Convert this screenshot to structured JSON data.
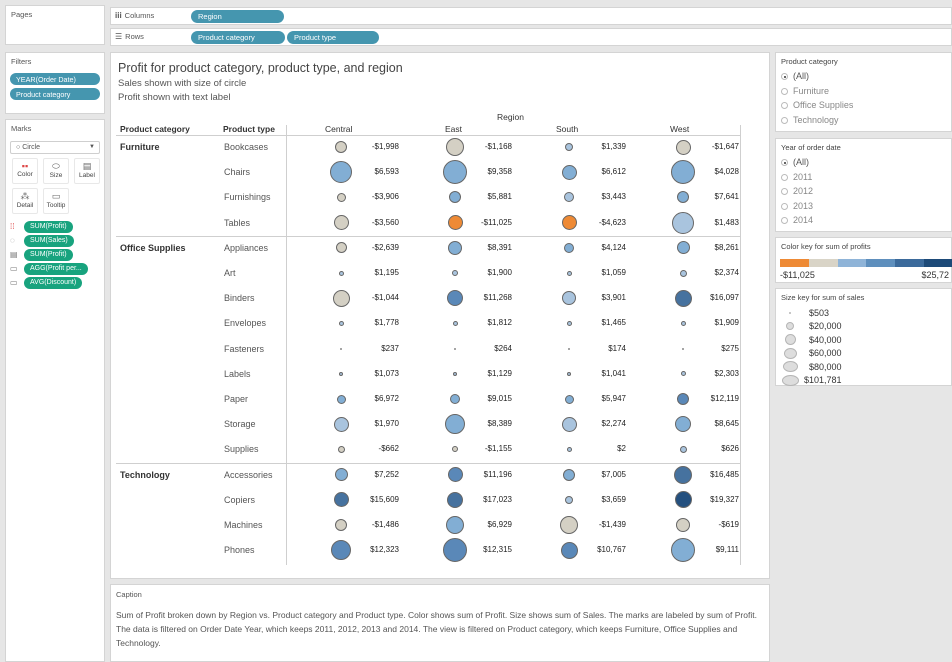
{
  "pages": {
    "title": "Pages"
  },
  "shelves": {
    "columns": {
      "icon": "iii",
      "label": "Columns",
      "pill": "Region"
    },
    "rows": {
      "icon": "☰",
      "label": "Rows",
      "pills": [
        "Product category",
        "Product type"
      ]
    }
  },
  "filters": {
    "title": "Filters",
    "items": [
      "YEAR(Order Date)",
      "Product category"
    ]
  },
  "marks": {
    "title": "Marks",
    "type": "Circle",
    "buttons": [
      {
        "label": "Color",
        "icon": "color-icon"
      },
      {
        "label": "Size",
        "icon": "size-icon"
      },
      {
        "label": "Label",
        "icon": "label-icon"
      },
      {
        "label": "Detail",
        "icon": "detail-icon"
      },
      {
        "label": "Tooltip",
        "icon": "tooltip-icon"
      }
    ],
    "fields": [
      {
        "icon": "color-icon",
        "label": "SUM(Profit)"
      },
      {
        "icon": "size-icon",
        "label": "SUM(Sales)"
      },
      {
        "icon": "label-icon",
        "label": "SUM(Profit)"
      },
      {
        "icon": "tooltip-icon",
        "label": "AGG(Profit per..."
      },
      {
        "icon": "tooltip-icon",
        "label": "AVG(Discount)"
      }
    ]
  },
  "view": {
    "title": "Profit for product category, product type, and region",
    "subtitle1": "Sales shown with size of circle",
    "subtitle2": "Profit shown with text label",
    "region_header": "Region",
    "col_category": "Product category",
    "col_type": "Product type",
    "regions": [
      "Central",
      "East",
      "South",
      "West"
    ]
  },
  "chart_data": {
    "type": "scatter",
    "title": "Profit for product category, product type, and region",
    "subtitle": "Sales shown with size of circle; Profit shown with text label",
    "columns": [
      "Central",
      "East",
      "South",
      "West"
    ],
    "groups": [
      {
        "category": "Furniture",
        "rows": [
          {
            "type": "Bookcases",
            "labels": [
              "-$1,998",
              "-$1,168",
              "$1,339",
              "-$1,647"
            ],
            "profit": [
              -1998,
              -1168,
              1339,
              -1647
            ],
            "size": [
              12,
              18,
              8,
              15
            ]
          },
          {
            "type": "Chairs",
            "labels": [
              "$6,593",
              "$9,358",
              "$6,612",
              "$4,028"
            ],
            "profit": [
              6593,
              9358,
              6612,
              4028
            ],
            "size": [
              22,
              24,
              15,
              24
            ]
          },
          {
            "type": "Furnishings",
            "labels": [
              "-$3,906",
              "$5,881",
              "$3,443",
              "$7,641"
            ],
            "profit": [
              -3906,
              5881,
              3443,
              7641
            ],
            "size": [
              9,
              12,
              10,
              12
            ]
          },
          {
            "type": "Tables",
            "labels": [
              "-$3,560",
              "-$11,025",
              "-$4,623",
              "$1,483"
            ],
            "profit": [
              -3560,
              -11025,
              -4623,
              1483
            ],
            "size": [
              15,
              15,
              15,
              22
            ]
          }
        ]
      },
      {
        "category": "Office Supplies",
        "rows": [
          {
            "type": "Appliances",
            "labels": [
              "-$2,639",
              "$8,391",
              "$4,124",
              "$8,261"
            ],
            "profit": [
              -2639,
              8391,
              4124,
              8261
            ],
            "size": [
              11,
              14,
              10,
              13
            ]
          },
          {
            "type": "Art",
            "labels": [
              "$1,195",
              "$1,900",
              "$1,059",
              "$2,374"
            ],
            "profit": [
              1195,
              1900,
              1059,
              2374
            ],
            "size": [
              5,
              6,
              5,
              7
            ]
          },
          {
            "type": "Binders",
            "labels": [
              "-$1,044",
              "$11,268",
              "$3,901",
              "$16,097"
            ],
            "profit": [
              -1044,
              11268,
              3901,
              16097
            ],
            "size": [
              17,
              16,
              14,
              17
            ]
          },
          {
            "type": "Envelopes",
            "labels": [
              "$1,778",
              "$1,812",
              "$1,465",
              "$1,909"
            ],
            "profit": [
              1778,
              1812,
              1465,
              1909
            ],
            "size": [
              5,
              5,
              5,
              5
            ]
          },
          {
            "type": "Fasteners",
            "labels": [
              "$237",
              "$264",
              "$174",
              "$275"
            ],
            "profit": [
              237,
              264,
              174,
              275
            ],
            "size": [
              2,
              2,
              2,
              2
            ]
          },
          {
            "type": "Labels",
            "labels": [
              "$1,073",
              "$1,129",
              "$1,041",
              "$2,303"
            ],
            "profit": [
              1073,
              1129,
              1041,
              2303
            ],
            "size": [
              4,
              4,
              4,
              5
            ]
          },
          {
            "type": "Paper",
            "labels": [
              "$6,972",
              "$9,015",
              "$5,947",
              "$12,119"
            ],
            "profit": [
              6972,
              9015,
              5947,
              12119
            ],
            "size": [
              9,
              10,
              9,
              12
            ]
          },
          {
            "type": "Storage",
            "labels": [
              "$1,970",
              "$8,389",
              "$2,274",
              "$8,645"
            ],
            "profit": [
              1970,
              8389,
              2274,
              8645
            ],
            "size": [
              15,
              20,
              15,
              16
            ]
          },
          {
            "type": "Supplies",
            "labels": [
              "-$662",
              "-$1,155",
              "$2",
              "$626"
            ],
            "profit": [
              -662,
              -1155,
              2,
              626
            ],
            "size": [
              7,
              6,
              5,
              7
            ]
          }
        ]
      },
      {
        "category": "Technology",
        "rows": [
          {
            "type": "Accessories",
            "labels": [
              "$7,252",
              "$11,196",
              "$7,005",
              "$16,485"
            ],
            "profit": [
              7252,
              11196,
              7005,
              16485
            ],
            "size": [
              13,
              15,
              12,
              18
            ]
          },
          {
            "type": "Copiers",
            "labels": [
              "$15,609",
              "$17,023",
              "$3,659",
              "$19,327"
            ],
            "profit": [
              15609,
              17023,
              3659,
              19327
            ],
            "size": [
              15,
              16,
              8,
              17
            ]
          },
          {
            "type": "Machines",
            "labels": [
              "-$1,486",
              "$6,929",
              "-$1,439",
              "-$619"
            ],
            "profit": [
              -1486,
              6929,
              -1439,
              -619
            ],
            "size": [
              12,
              18,
              18,
              14
            ]
          },
          {
            "type": "Phones",
            "labels": [
              "$12,323",
              "$12,315",
              "$10,767",
              "$9,111"
            ],
            "profit": [
              12323,
              12315,
              10767,
              9111
            ],
            "size": [
              20,
              24,
              17,
              24
            ]
          }
        ]
      }
    ],
    "color_range": [
      -11025,
      25720
    ]
  },
  "product_category": {
    "title": "Product category",
    "options": [
      {
        "label": "(All)",
        "selected": true
      },
      {
        "label": "Furniture",
        "selected": false
      },
      {
        "label": "Office Supplies",
        "selected": false
      },
      {
        "label": "Technology",
        "selected": false
      }
    ]
  },
  "order_year": {
    "title": "Year of order date",
    "options": [
      {
        "label": "(All)",
        "selected": true
      },
      {
        "label": "2011",
        "selected": false
      },
      {
        "label": "2012",
        "selected": false
      },
      {
        "label": "2013",
        "selected": false
      },
      {
        "label": "2014",
        "selected": false
      }
    ]
  },
  "color_key": {
    "title": "Color key for sum of profits",
    "min_label": "-$11,025",
    "max_label": "$25,72",
    "colors": [
      "#ee8a35",
      "#d9d4c7",
      "#8fb4d8",
      "#5e8fbd",
      "#3b6a9b",
      "#1d4a78"
    ]
  },
  "size_key": {
    "title": "Size key for sum of sales",
    "items": [
      "$503",
      "$20,000",
      "$40,000",
      "$60,000",
      "$80,000",
      "$101,781"
    ]
  },
  "caption": {
    "title": "Caption",
    "text": "Sum of Profit broken down by Region vs. Product category and Product type.  Color shows sum of Profit.  Size shows sum of Sales.  The marks are labeled by sum of Profit. The data is filtered on Order Date Year, which keeps 2011, 2012, 2013 and 2014. The view is filtered on Product category, which keeps Furniture, Office Supplies and Technology."
  }
}
